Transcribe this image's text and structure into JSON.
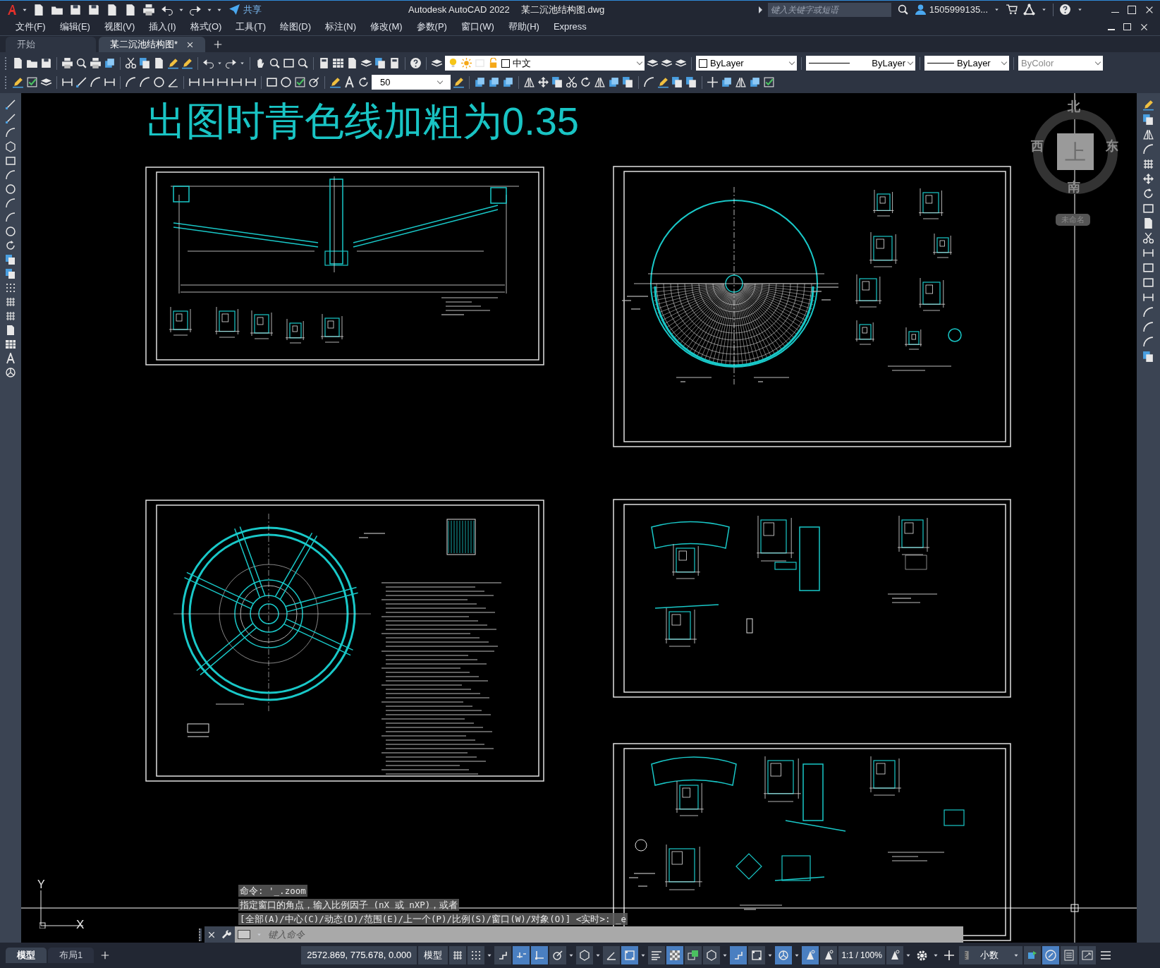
{
  "title_bar": {
    "share": "共享",
    "app_title": "Autodesk AutoCAD 2022",
    "file_name": "某二沉池结构图.dwg",
    "search": {
      "placeholder": "键入关键字或短语"
    },
    "user": "1505999135..."
  },
  "menu_bar": [
    "文件(F)",
    "编辑(E)",
    "视图(V)",
    "插入(I)",
    "格式(O)",
    "工具(T)",
    "绘图(D)",
    "标注(N)",
    "修改(M)",
    "参数(P)",
    "窗口(W)",
    "帮助(H)",
    "Express"
  ],
  "doc_tabs": [
    {
      "label": "开始",
      "selected": false
    },
    {
      "label": "某二沉池结构图*",
      "selected": true
    }
  ],
  "toolbar": {
    "layer": "中文",
    "dim_scale": "50",
    "color_setting": "ByLayer",
    "linetype": "ByLayer",
    "lineweight": "ByLayer",
    "plot_style": {
      "value": "ByColor",
      "disabled": true
    }
  },
  "canvas": {
    "note": "出图时青色线加粗为0.35",
    "viewcube": {
      "north": "北",
      "west": "西",
      "top": "上",
      "east": "东",
      "south": "南",
      "coordinate_system": "未命名"
    },
    "ucs": {
      "y": "Y",
      "x": "X"
    }
  },
  "command_history": [
    "命令: '_.zoom",
    "指定窗口的角点，输入比例因子 (nX 或 nXP)，或者",
    "[全部(A)/中心(C)/动态(D)/范围(E)/上一个(P)/比例(S)/窗口(W)/对象(O)] <实时>: _e"
  ],
  "command_input": {
    "placeholder": "键入命令"
  },
  "layout_tabs": [
    {
      "label": "模型",
      "selected": true
    },
    {
      "label": "布局1",
      "selected": false
    }
  ],
  "status_bar": {
    "coordinates": "2572.869, 775.678, 0.000",
    "space": "模型",
    "annotation_scale": "1:1 / 100%",
    "units": "小数"
  },
  "status_toggles": [
    {
      "kind": "grid",
      "on": false
    },
    {
      "kind": "snap",
      "on": false
    },
    {
      "kind": "infer",
      "on": false
    },
    {
      "kind": "dynamic-input",
      "on": true
    },
    {
      "kind": "ortho",
      "on": true
    },
    {
      "kind": "polar",
      "on": false
    },
    {
      "kind": "isodraft",
      "on": false
    },
    {
      "kind": "tracking",
      "on": false
    },
    {
      "kind": "osnap",
      "on": true
    },
    {
      "kind": "lineweight",
      "on": false
    },
    {
      "kind": "transparency",
      "on": true
    },
    {
      "kind": "cycling",
      "on": false
    },
    {
      "kind": "osnap3d",
      "on": false
    },
    {
      "kind": "ducs",
      "on": true
    },
    {
      "kind": "filter",
      "on": false
    },
    {
      "kind": "gizmo",
      "on": true
    },
    {
      "kind": "annovis",
      "on": true
    },
    {
      "kind": "autoscale",
      "on": false
    },
    {
      "kind": "annoscale",
      "on": false
    }
  ],
  "status_tools": [
    {
      "kind": "isolate",
      "on": false
    },
    {
      "kind": "hardware",
      "on": true
    },
    {
      "kind": "props",
      "on": false
    },
    {
      "kind": "fullscreen",
      "on": false
    }
  ]
}
